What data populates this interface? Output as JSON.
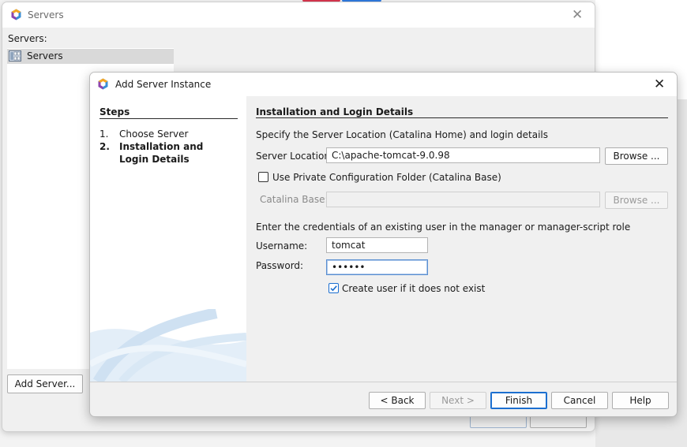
{
  "servers_window": {
    "title": "Servers",
    "servers_label": "Servers:",
    "list_items": [
      "Servers"
    ],
    "add_server_button": "Add Server..."
  },
  "wizard": {
    "title": "Add Server Instance",
    "steps_title": "Steps",
    "steps": [
      {
        "num": "1.",
        "label": "Choose Server"
      },
      {
        "num": "2.",
        "label": "Installation and Login Details"
      }
    ],
    "panel_title": "Installation and Login Details",
    "location_intro": "Specify the Server Location (Catalina Home) and login details",
    "server_location_label": "Server Location:",
    "server_location_value": "C:\\apache-tomcat-9.0.98",
    "browse_label": "Browse ...",
    "private_config_label": "Use Private Configuration Folder (Catalina Base)",
    "catalina_base_label": "Catalina Base:",
    "catalina_base_value": "",
    "credentials_intro": "Enter the credentials of an existing user in the manager or manager-script role",
    "username_label": "Username:",
    "username_value": "tomcat",
    "password_label": "Password:",
    "password_value": "••••••",
    "create_user_label": "Create user if it does not exist",
    "create_user_checked": true,
    "private_config_checked": false,
    "buttons": {
      "back": "< Back",
      "next": "Next >",
      "finish": "Finish",
      "cancel": "Cancel",
      "help": "Help"
    }
  },
  "icons": {
    "app_logo": "netbeans-logo-icon",
    "close": "close-icon",
    "server": "server-icon"
  },
  "colors": {
    "accent": "#1c6fd0",
    "logo_orange": "#f5a623",
    "logo_purple": "#8e44ad",
    "logo_blue": "#3b8fd6",
    "logo_green": "#57b33e"
  }
}
